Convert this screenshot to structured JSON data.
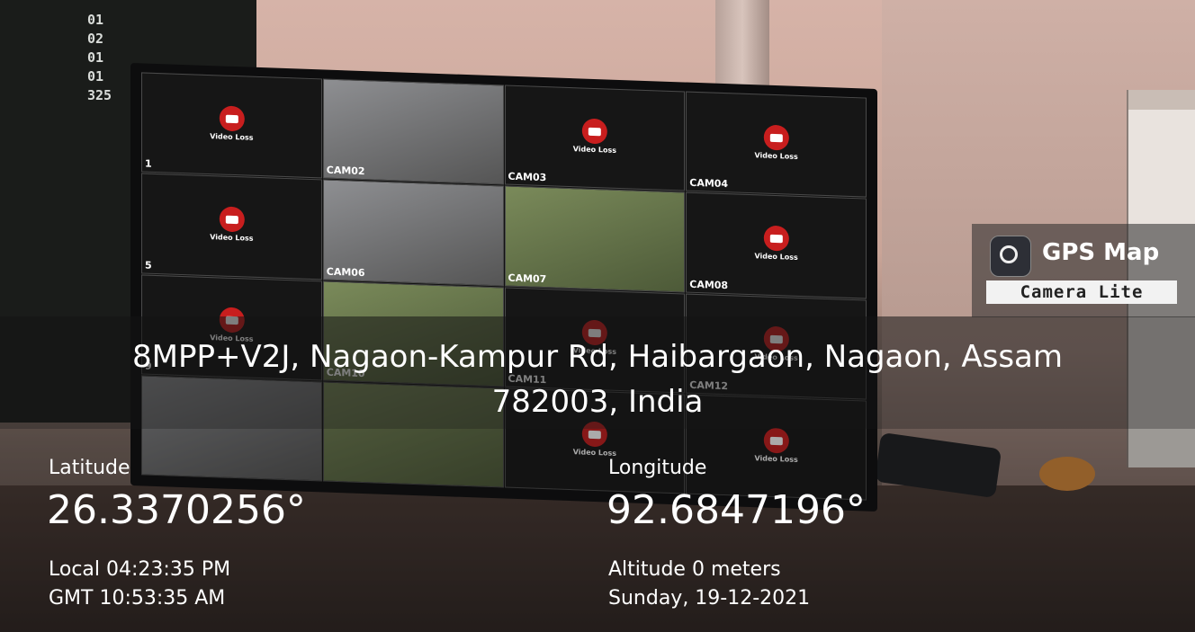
{
  "background": {
    "led_board_lines": [
      "01",
      "02",
      "01",
      "01",
      "325"
    ],
    "cctv": {
      "cells": [
        {
          "label": "1",
          "video_loss": true,
          "feed": "none"
        },
        {
          "label": "CAM02",
          "video_loss": false,
          "feed": "room"
        },
        {
          "label": "CAM03",
          "video_loss": true,
          "feed": "none"
        },
        {
          "label": "CAM04",
          "video_loss": true,
          "feed": "none"
        },
        {
          "label": "5",
          "video_loss": true,
          "feed": "none"
        },
        {
          "label": "CAM06",
          "video_loss": false,
          "feed": "room"
        },
        {
          "label": "CAM07",
          "video_loss": false,
          "feed": "green"
        },
        {
          "label": "CAM08",
          "video_loss": true,
          "feed": "none"
        },
        {
          "label": "9",
          "video_loss": true,
          "feed": "none"
        },
        {
          "label": "CAM10",
          "video_loss": false,
          "feed": "green"
        },
        {
          "label": "CAM11",
          "video_loss": true,
          "feed": "none"
        },
        {
          "label": "CAM12",
          "video_loss": true,
          "feed": "none"
        },
        {
          "label": "",
          "video_loss": false,
          "feed": "room"
        },
        {
          "label": "",
          "video_loss": false,
          "feed": "green"
        },
        {
          "label": "",
          "video_loss": true,
          "feed": "none"
        },
        {
          "label": "",
          "video_loss": true,
          "feed": "none"
        }
      ],
      "video_loss_text": "Video Loss"
    }
  },
  "badge": {
    "title": "GPS Map",
    "subtitle": "Camera Lite",
    "icon": "camera-lens-icon"
  },
  "address": {
    "line1": "8MPP+V2J, Nagaon-Kampur Rd, Haibargaon, Nagaon, Assam",
    "line2": "782003, India"
  },
  "coords": {
    "latitude_label": "Latitude",
    "latitude_value": "26.3370256°",
    "longitude_label": "Longitude",
    "longitude_value": "92.6847196°"
  },
  "time": {
    "local": "Local 04:23:35 PM",
    "gmt": "GMT 10:53:35 AM",
    "altitude": "Altitude 0 meters",
    "date": "Sunday, 19-12-2021"
  }
}
